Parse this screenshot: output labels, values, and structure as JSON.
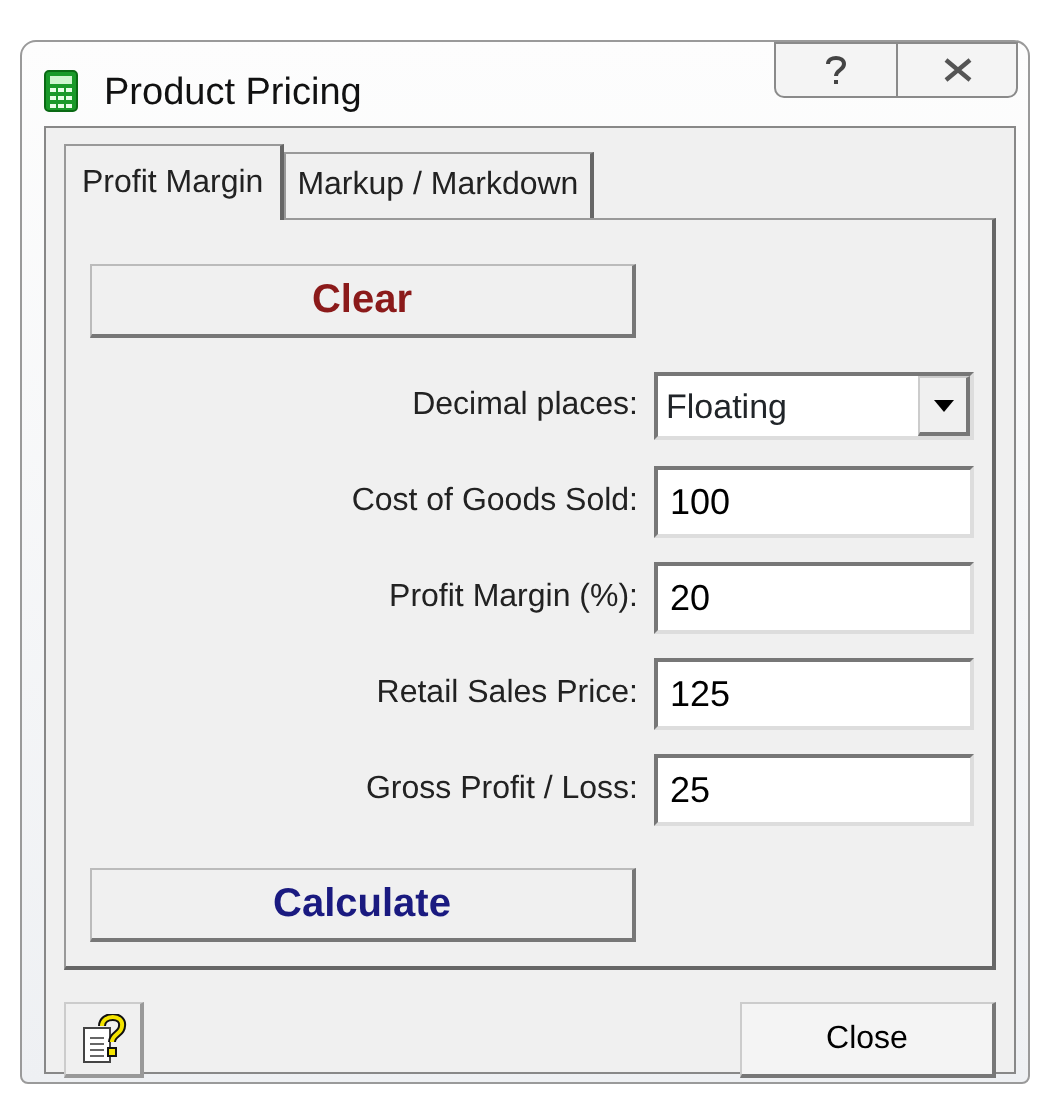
{
  "window": {
    "title": "Product Pricing"
  },
  "tabs": [
    {
      "label": "Profit Margin",
      "selected": true
    },
    {
      "label": "Markup / Markdown",
      "selected": false
    }
  ],
  "clear_button": "Clear",
  "fields": [
    {
      "kind": "dropdown",
      "label": "Decimal places:",
      "value": "Floating"
    },
    {
      "kind": "text",
      "label": "Cost of Goods Sold:",
      "value": "100"
    },
    {
      "kind": "text",
      "label": "Profit Margin (%):",
      "value": "20"
    },
    {
      "kind": "text",
      "label": "Retail Sales Price:",
      "value": "125"
    },
    {
      "kind": "text",
      "label": "Gross Profit / Loss:",
      "value": "25"
    }
  ],
  "calculate_button": "Calculate",
  "close_button": "Close"
}
